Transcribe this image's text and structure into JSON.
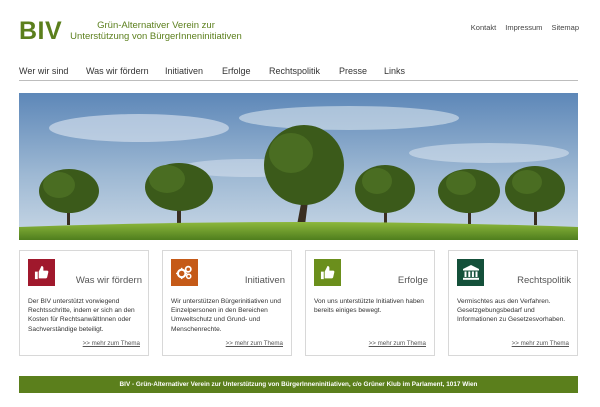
{
  "header": {
    "logo": "BIV",
    "tagline_line1": "Grün-Alternativer Verein zur",
    "tagline_line2": "Unterstützung von BürgerInneninitiativen",
    "utility_links": [
      "Kontakt",
      "Impressum",
      "Sitemap"
    ]
  },
  "nav": {
    "items": [
      "Wer wir sind",
      "Was wir fördern",
      "Initiativen",
      "Erfolge",
      "Rechtspolitik",
      "Presse",
      "Links"
    ]
  },
  "colors": {
    "brand_green": "#5b7f1c",
    "card1_icon": "#a0182c",
    "card2_icon": "#c55a18",
    "card3_icon": "#6b8f1c",
    "card4_icon": "#14503a"
  },
  "cards": [
    {
      "title": "Was wir fördern",
      "icon": "thumbs-up-icon",
      "description": "Der BIV unterstützt vorwiegend Rechtsschritte, indem er sich an den Kosten für RechtsanwältInnen oder Sachverständige beteiligt.",
      "more": ">> mehr zum Thema"
    },
    {
      "title": "Initiativen",
      "icon": "gears-icon",
      "description": "Wir unterstützen Bürgerinitiativen und Einzelpersonen in den Bereichen Umweltschutz und Grund- und Menschenrechte.",
      "more": ">> mehr zum Thema"
    },
    {
      "title": "Erfolge",
      "icon": "thumbs-up-icon",
      "description": "Von uns unterstützte Initiativen haben bereits einiges bewegt.",
      "more": ">> mehr zum Thema"
    },
    {
      "title": "Rechtspolitik",
      "icon": "institution-icon",
      "description": "Vermischtes aus den Verfahren. Gesetzgebungsbedarf und Informationen zu Gesetzesvorhaben.",
      "more": ">> mehr zum Thema"
    }
  ],
  "footer": {
    "text": "BIV - Grün-Alternativer Verein zur Unterstützung von BürgerInneninitiativen, c/o Grüner Klub im Parlament, 1017 Wien"
  }
}
